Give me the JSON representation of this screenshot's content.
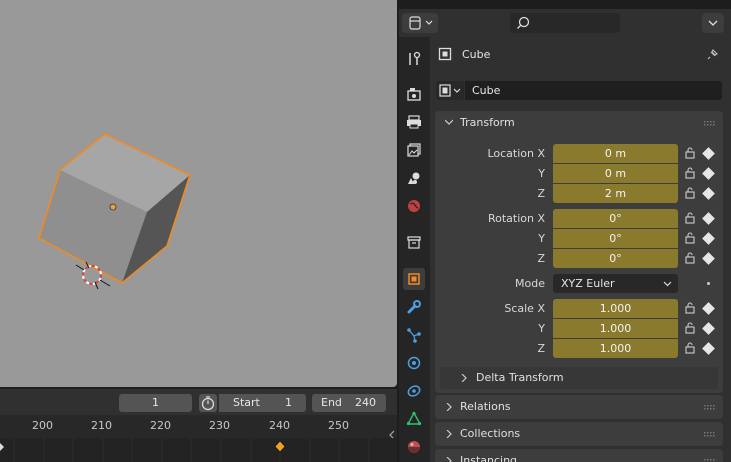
{
  "timeline": {
    "current_frame": "1",
    "start_label": "Start",
    "start_value": "1",
    "end_label": "End",
    "end_value": "240",
    "ruler_labels": [
      "200",
      "210",
      "220",
      "230",
      "240",
      "250"
    ]
  },
  "properties": {
    "object_name": "Cube",
    "datablock_name": "Cube",
    "transform": {
      "title": "Transform",
      "location_label": "Location X",
      "y_label": "Y",
      "z_label": "Z",
      "location": [
        "0 m",
        "0 m",
        "2 m"
      ],
      "rotation_label": "Rotation X",
      "rotation": [
        "0°",
        "0°",
        "0°"
      ],
      "mode_label": "Mode",
      "mode_value": "XYZ Euler",
      "scale_label": "Scale X",
      "scale": [
        "1.000",
        "1.000",
        "1.000"
      ]
    },
    "delta_transform": "Delta Transform",
    "relations": "Relations",
    "collections": "Collections",
    "instancing": "Instancing"
  },
  "colors": {
    "accent_selection": "#f08a24",
    "field_animated": "#8a7a2e",
    "viewport_bg": "#999999"
  }
}
